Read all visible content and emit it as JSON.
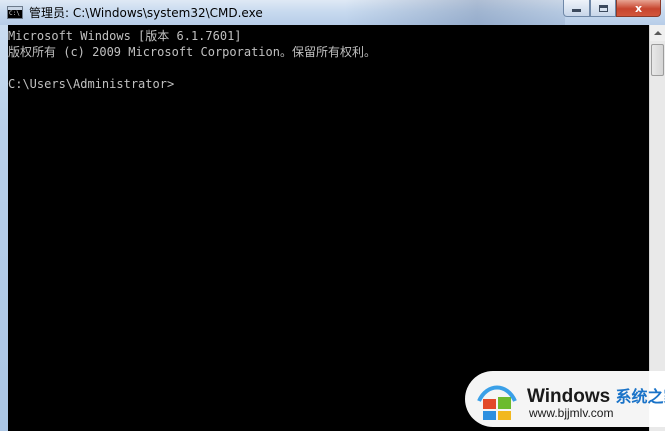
{
  "window": {
    "title": "管理员: C:\\Windows\\system32\\CMD.exe",
    "icon": "cmd-icon",
    "controls": {
      "minimize": "minimize-icon",
      "maximize": "maximize-icon",
      "close": "x"
    }
  },
  "console": {
    "lines": [
      "Microsoft Windows [版本 6.1.7601]",
      "版权所有 (c) 2009 Microsoft Corporation。保留所有权利。",
      "",
      "C:\\Users\\Administrator>"
    ],
    "colors": {
      "background": "#000000",
      "foreground": "#c0c0c0"
    }
  },
  "watermark": {
    "brand": "Windows",
    "brand_cn": "系统之家",
    "url": "www.bjjmlv.com"
  }
}
